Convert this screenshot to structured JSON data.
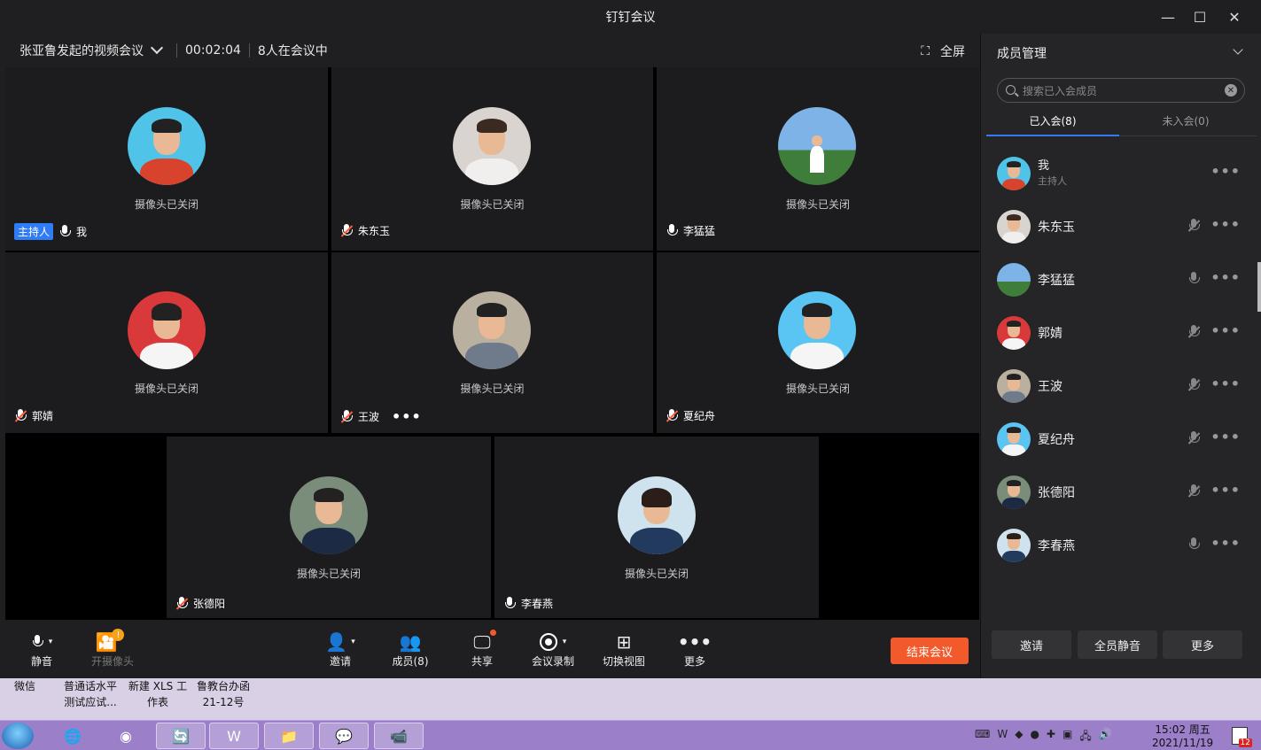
{
  "window": {
    "title": "钉钉会议"
  },
  "meeting": {
    "name": "张亚鲁发起的视频会议",
    "duration": "00:02:04",
    "count_text": "8人在会议中",
    "fullscreen_label": "全屏"
  },
  "tiles": [
    {
      "name": "我",
      "status": "摄像头已关闭",
      "host_badge": "主持人",
      "muted": false
    },
    {
      "name": "朱东玉",
      "status": "摄像头已关闭",
      "muted": true
    },
    {
      "name": "李猛猛",
      "status": "摄像头已关闭",
      "muted": false
    },
    {
      "name": "郭婧",
      "status": "摄像头已关闭",
      "muted": true
    },
    {
      "name": "王波",
      "status": "摄像头已关闭",
      "muted": true,
      "more": "•••"
    },
    {
      "name": "夏纪舟",
      "status": "摄像头已关闭",
      "muted": true
    },
    {
      "name": "张德阳",
      "status": "摄像头已关闭",
      "muted": true
    },
    {
      "name": "李春燕",
      "status": "摄像头已关闭",
      "muted": false
    }
  ],
  "toolbar": {
    "mute": "静音",
    "camera": "开摄像头",
    "invite": "邀请",
    "members": "成员(8)",
    "share": "共享",
    "record": "会议录制",
    "switch_view": "切换视图",
    "more": "更多",
    "end": "结束会议"
  },
  "sidebar": {
    "title": "成员管理",
    "search_placeholder": "搜索已入会成员",
    "tab_joined": "已入会(8)",
    "tab_not_joined": "未入会(0)",
    "members": [
      {
        "name": "我",
        "role": "主持人"
      },
      {
        "name": "朱东玉",
        "muted": true
      },
      {
        "name": "李猛猛",
        "muted": false
      },
      {
        "name": "郭婧",
        "muted": true
      },
      {
        "name": "王波",
        "muted": true
      },
      {
        "name": "夏纪舟",
        "muted": true
      },
      {
        "name": "张德阳",
        "muted": true
      },
      {
        "name": "李春燕",
        "muted": false
      }
    ],
    "more_dots": "•••",
    "btn_invite": "邀请",
    "btn_mute_all": "全员静音",
    "btn_more": "更多"
  },
  "desktop": {
    "icon1": "微信",
    "icon2_line1": "普通话水平",
    "icon2_line2": "测试应试...",
    "icon3_line1": "新建 XLS 工",
    "icon3_line2": "作表",
    "icon4_line1": "鲁教台办函",
    "icon4_line2": "21-12号"
  },
  "taskbar": {
    "time": "15:02 周五",
    "date": "2021/11/19",
    "notify_count": "12"
  }
}
